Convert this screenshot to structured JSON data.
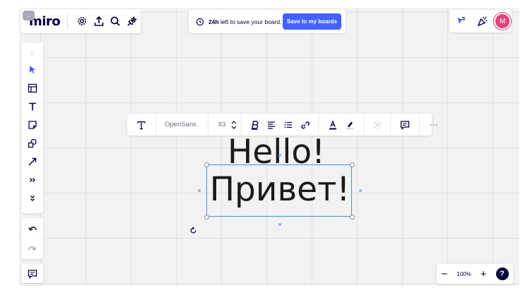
{
  "app": {
    "logo": "miro",
    "board_badge_icon": "board-switch-icon"
  },
  "toolbar_top_left": {
    "icons": [
      "settings-icon",
      "upload-icon",
      "search-icon",
      "plugin-icon"
    ]
  },
  "save_banner": {
    "time_bold": "24h",
    "text": "left to save your board.",
    "button_label": "Save to my boards",
    "button_color": "#4262ff"
  },
  "top_right": {
    "icons": [
      "cursor-follow-icon",
      "celebrate-icon"
    ],
    "avatar_initial": "M",
    "avatar_color": "#e2437b"
  },
  "left_tools": {
    "items": [
      "select-icon",
      "templates-icon",
      "text-icon",
      "sticky-note-icon",
      "shapes-icon",
      "arrow-icon",
      "more-tools-icon",
      "expand-icon"
    ]
  },
  "format_toolbar": {
    "font_name": "OpenSans",
    "font_size": "83"
  },
  "canvas": {
    "text_line1": "Hello!",
    "text_line2": "Привет!"
  },
  "zoom": {
    "level": "100%",
    "minus": "−",
    "plus": "+",
    "help": "?"
  }
}
